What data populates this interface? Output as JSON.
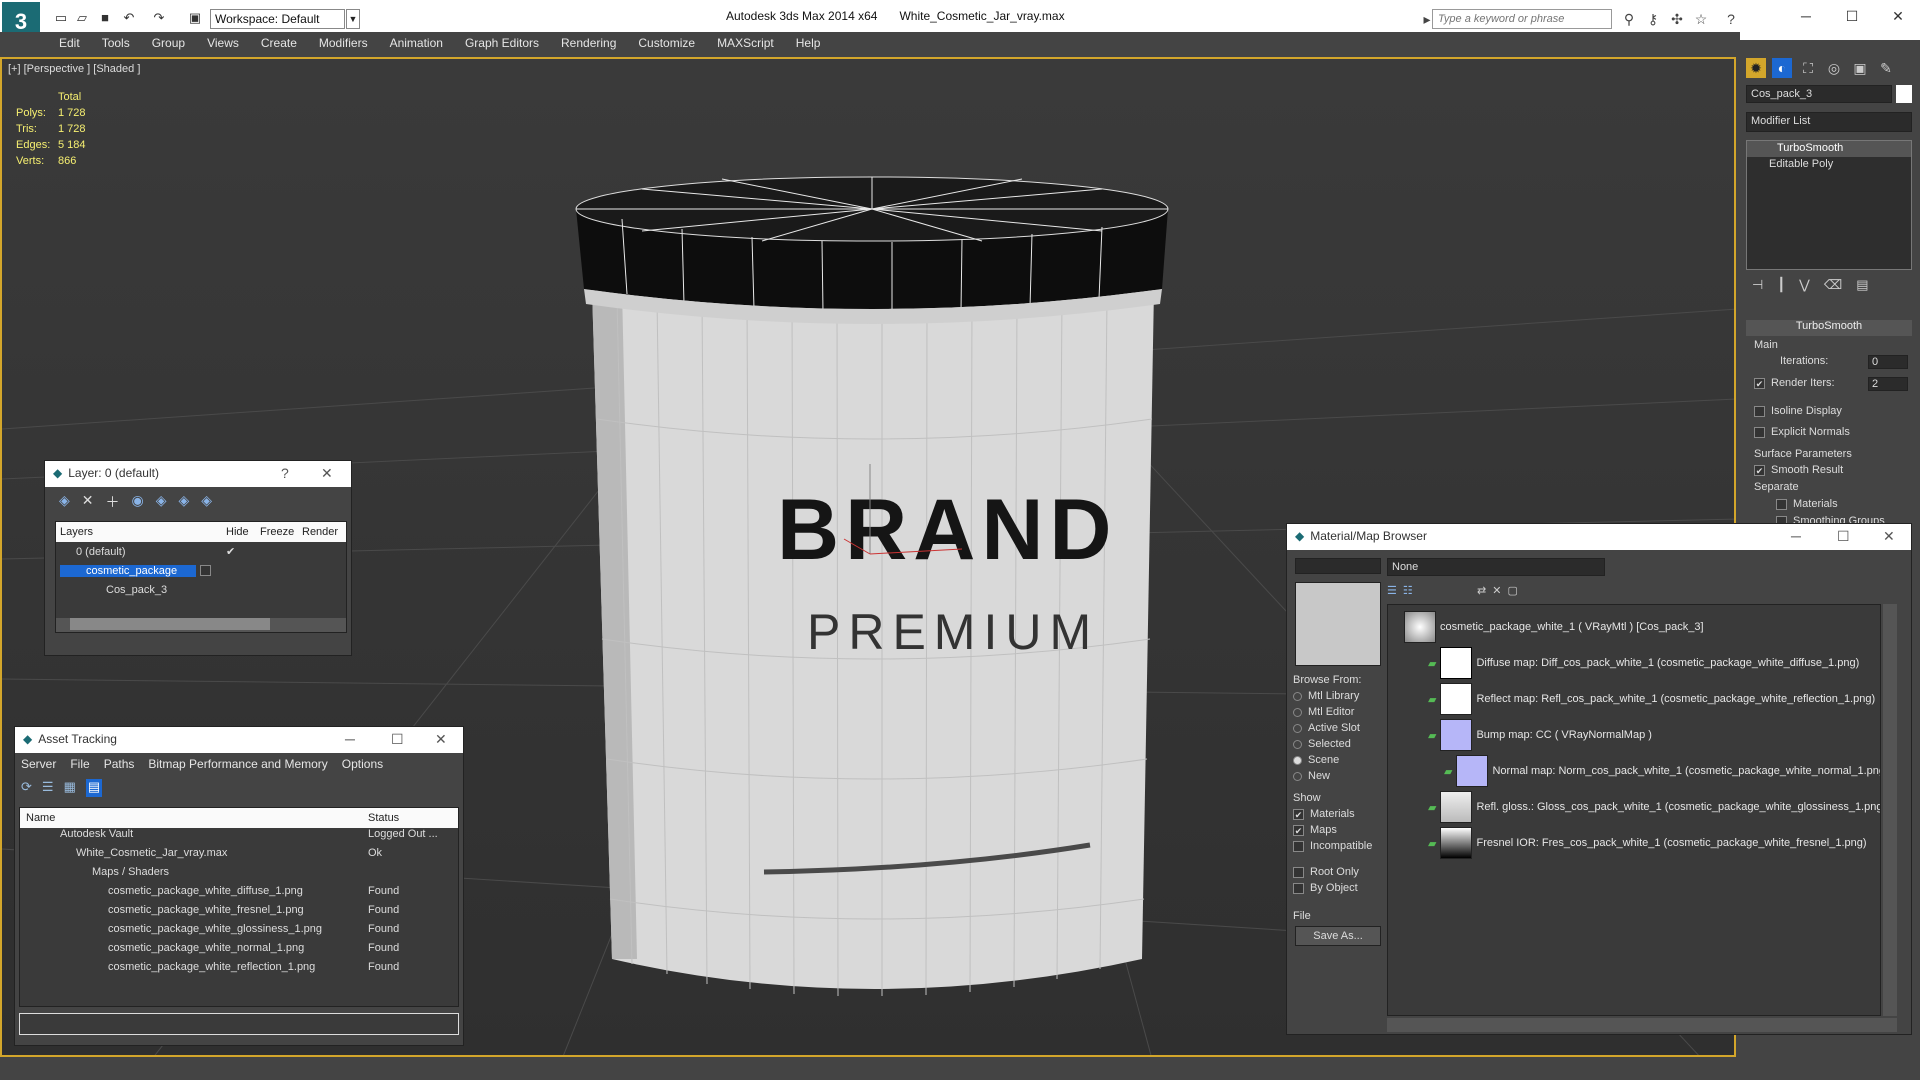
{
  "titlebar": {
    "workspace": "Workspace: Default",
    "app_name": "Autodesk 3ds Max  2014 x64",
    "file_name": "White_Cosmetic_Jar_vray.max",
    "search_placeholder": "Type a keyword or phrase"
  },
  "menu": [
    "Edit",
    "Tools",
    "Group",
    "Views",
    "Create",
    "Modifiers",
    "Animation",
    "Graph Editors",
    "Rendering",
    "Customize",
    "MAXScript",
    "Help"
  ],
  "viewport": {
    "label": "[+] [Perspective ] [Shaded ]",
    "stats_header": "Total",
    "stats": [
      {
        "k": "Polys:",
        "v": "1 728"
      },
      {
        "k": "Tris:",
        "v": "1 728"
      },
      {
        "k": "Edges:",
        "v": "5 184"
      },
      {
        "k": "Verts:",
        "v": "866"
      }
    ],
    "label_brand": "BRAND",
    "label_premium": "PREMIUM"
  },
  "layer_panel": {
    "title": "Layer: 0 (default)",
    "help": "?",
    "cols": [
      "Layers",
      "Hide",
      "Freeze",
      "Render"
    ],
    "rows": [
      "0 (default)",
      "cosmetic_package",
      "Cos_pack_3"
    ]
  },
  "asset_panel": {
    "title": "Asset Tracking",
    "menu": [
      "Server",
      "File",
      "Paths",
      "Bitmap Performance and Memory",
      "Options"
    ],
    "col_name": "Name",
    "col_status": "Status",
    "rows": [
      {
        "name": "Autodesk Vault",
        "status": "Logged Out ..."
      },
      {
        "name": "White_Cosmetic_Jar_vray.max",
        "status": "Ok"
      },
      {
        "name": "Maps / Shaders",
        "status": ""
      },
      {
        "name": "cosmetic_package_white_diffuse_1.png",
        "status": "Found"
      },
      {
        "name": "cosmetic_package_white_fresnel_1.png",
        "status": "Found"
      },
      {
        "name": "cosmetic_package_white_glossiness_1.png",
        "status": "Found"
      },
      {
        "name": "cosmetic_package_white_normal_1.png",
        "status": "Found"
      },
      {
        "name": "cosmetic_package_white_reflection_1.png",
        "status": "Found"
      }
    ]
  },
  "command_panel": {
    "object_name": "Cos_pack_3",
    "modifier_list": "Modifier List",
    "stack": [
      "TurboSmooth",
      "Editable Poly"
    ],
    "rollout_title": "TurboSmooth",
    "main": "Main",
    "iterations_label": "Iterations:",
    "iterations_value": "0",
    "render_iters_label": "Render Iters:",
    "render_iters_value": "2",
    "isoline": "Isoline Display",
    "explicit": "Explicit Normals",
    "surface": "Surface Parameters",
    "smooth": "Smooth Result",
    "separate": "Separate",
    "materials": "Materials",
    "smoothing_groups": "Smoothing Groups"
  },
  "material_browser": {
    "title": "Material/Map Browser",
    "search_value": "None",
    "browse_from": "Browse From:",
    "browse_options": [
      "Mtl Library",
      "Mtl Editor",
      "Active Slot",
      "Selected",
      "Scene",
      "New"
    ],
    "show": "Show",
    "show_options": [
      "Materials",
      "Maps",
      "Incompatible"
    ],
    "root_only": "Root Only",
    "by_object": "By Object",
    "file": "File",
    "save_as": "Save As...",
    "tree": [
      "cosmetic_package_white_1  ( VRayMtl )  [Cos_pack_3]",
      "Diffuse map: Diff_cos_pack_white_1 (cosmetic_package_white_diffuse_1.png)",
      "Reflect map: Refl_cos_pack_white_1 (cosmetic_package_white_reflection_1.png)",
      "Bump map: CC  ( VRayNormalMap )",
      "Normal map: Norm_cos_pack_white_1 (cosmetic_package_white_normal_1.png)",
      "Refl. gloss.: Gloss_cos_pack_white_1 (cosmetic_package_white_glossiness_1.png)",
      "Fresnel IOR: Fres_cos_pack_white_1 (cosmetic_package_white_fresnel_1.png)"
    ]
  },
  "colors": {
    "accent": "#d3a62b",
    "selection": "#1c68d2",
    "found": "#e6e6e6"
  }
}
